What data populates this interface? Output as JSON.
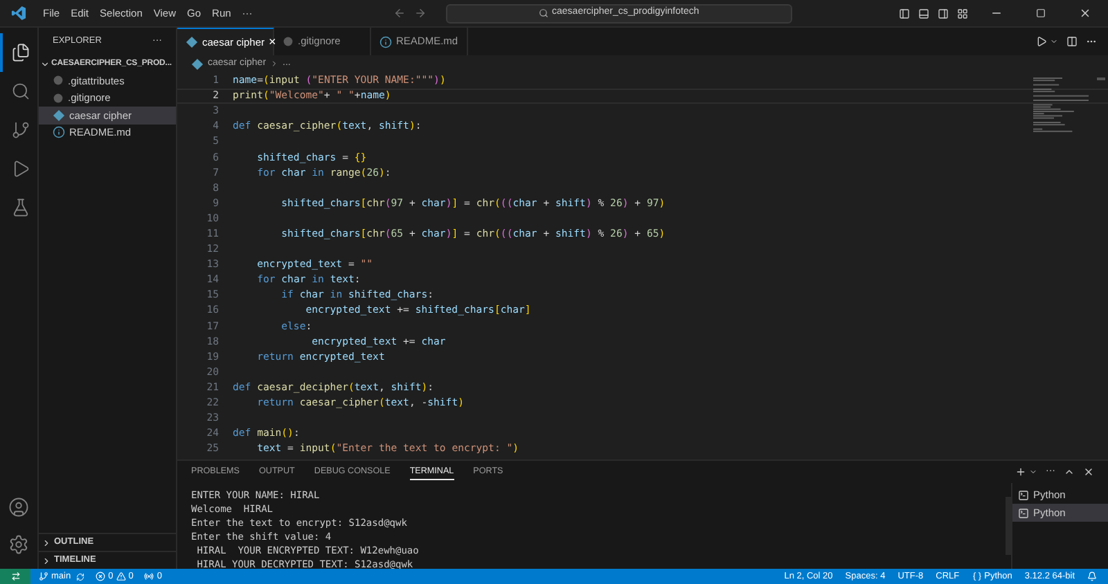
{
  "title_bar": {
    "menus": [
      "File",
      "Edit",
      "Selection",
      "View",
      "Go",
      "Run",
      "···"
    ],
    "search": {
      "value": "caesaercipher_cs_prodigyinfotech"
    }
  },
  "activity_bar": {
    "items": [
      {
        "kind": "files",
        "selected": true
      },
      {
        "kind": "search",
        "selected": false
      },
      {
        "kind": "source-control",
        "selected": false
      },
      {
        "kind": "run",
        "selected": false
      },
      {
        "kind": "testing",
        "selected": false
      }
    ]
  },
  "sidebar": {
    "title": "EXPLORER",
    "more": "···",
    "folder": {
      "name": "CAESAERCIPHER_CS_PROD...",
      "expanded": true,
      "files": [
        {
          "name": ".gitattributes",
          "kind": "config",
          "selected": false
        },
        {
          "name": ".gitignore",
          "kind": "config",
          "selected": false
        },
        {
          "name": "caesar cipher",
          "kind": "python",
          "selected": true
        },
        {
          "name": "README.md",
          "kind": "info",
          "selected": false
        }
      ]
    },
    "sections": [
      {
        "label": "OUTLINE",
        "expanded": false
      },
      {
        "label": "TIMELINE",
        "expanded": false
      }
    ]
  },
  "tabs": [
    {
      "label": "caesar cipher",
      "kind": "python",
      "selected": true,
      "close": "×"
    },
    {
      "label": ".gitignore",
      "kind": "config",
      "selected": false
    },
    {
      "label": "README.md",
      "kind": "info",
      "selected": false
    }
  ],
  "breadcrumb": {
    "file": "caesar cipher",
    "rest": "..."
  },
  "editor": {
    "lines": [
      {
        "number": "1",
        "current": false,
        "tokens": [
          {
            "kind": "var",
            "text": "name"
          },
          {
            "kind": "plain",
            "text": "="
          },
          {
            "kind": "bracket",
            "text": "("
          },
          {
            "kind": "func",
            "text": "input "
          },
          {
            "kind": "bracket2",
            "text": "("
          },
          {
            "kind": "string",
            "text": "\"ENTER YOUR NAME:\"\"\""
          },
          {
            "kind": "bracket2",
            "text": ")"
          },
          {
            "kind": "bracket",
            "text": ")"
          }
        ]
      },
      {
        "number": "2",
        "current": true,
        "tokens": [
          {
            "kind": "func",
            "text": "print"
          },
          {
            "kind": "bracket",
            "text": "("
          },
          {
            "kind": "string",
            "text": "\"Welcome\""
          },
          {
            "kind": "plain",
            "text": "+ "
          },
          {
            "kind": "string",
            "text": "\" \""
          },
          {
            "kind": "plain",
            "text": "+"
          },
          {
            "kind": "var",
            "text": "name"
          },
          {
            "kind": "bracket",
            "text": ")"
          }
        ]
      },
      {
        "number": "3",
        "current": false
      },
      {
        "number": "4",
        "current": false,
        "tokens": [
          {
            "kind": "keyword",
            "text": "def "
          },
          {
            "kind": "func",
            "text": "caesar_cipher"
          },
          {
            "kind": "bracket",
            "text": "("
          },
          {
            "kind": "var",
            "text": "text"
          },
          {
            "kind": "plain",
            "text": ", "
          },
          {
            "kind": "var",
            "text": "shift"
          },
          {
            "kind": "bracket",
            "text": ")"
          },
          {
            "kind": "plain",
            "text": ":"
          }
        ]
      },
      {
        "number": "5",
        "current": false
      },
      {
        "number": "6",
        "current": false,
        "tokens": [
          {
            "kind": "var",
            "text": "    shifted_chars"
          },
          {
            "kind": "plain",
            "text": " = "
          },
          {
            "kind": "bracket",
            "text": "{}"
          }
        ]
      },
      {
        "number": "7",
        "current": false,
        "tokens": [
          {
            "kind": "keyword",
            "text": "    for "
          },
          {
            "kind": "var",
            "text": "char "
          },
          {
            "kind": "keyword",
            "text": "in "
          },
          {
            "kind": "func",
            "text": "range"
          },
          {
            "kind": "bracket",
            "text": "("
          },
          {
            "kind": "number",
            "text": "26"
          },
          {
            "kind": "bracket",
            "text": ")"
          },
          {
            "kind": "plain",
            "text": ":"
          }
        ]
      },
      {
        "number": "8",
        "current": false
      },
      {
        "number": "9",
        "current": false,
        "tokens": [
          {
            "kind": "var",
            "text": "        shifted_chars"
          },
          {
            "kind": "bracket",
            "text": "["
          },
          {
            "kind": "func",
            "text": "chr"
          },
          {
            "kind": "bracket2",
            "text": "("
          },
          {
            "kind": "number",
            "text": "97"
          },
          {
            "kind": "plain",
            "text": " + "
          },
          {
            "kind": "var",
            "text": "char"
          },
          {
            "kind": "bracket2",
            "text": ")"
          },
          {
            "kind": "bracket",
            "text": "]"
          },
          {
            "kind": "plain",
            "text": " = "
          },
          {
            "kind": "func",
            "text": "chr"
          },
          {
            "kind": "bracket",
            "text": "("
          },
          {
            "kind": "bracket2",
            "text": "(("
          },
          {
            "kind": "var",
            "text": "char"
          },
          {
            "kind": "plain",
            "text": " + "
          },
          {
            "kind": "var",
            "text": "shift"
          },
          {
            "kind": "bracket2",
            "text": ")"
          },
          {
            "kind": "plain",
            "text": " % "
          },
          {
            "kind": "number",
            "text": "26"
          },
          {
            "kind": "bracket2",
            "text": ")"
          },
          {
            "kind": "plain",
            "text": " + "
          },
          {
            "kind": "number",
            "text": "97"
          },
          {
            "kind": "bracket",
            "text": ")"
          }
        ]
      },
      {
        "number": "10",
        "current": false
      },
      {
        "number": "11",
        "current": false,
        "tokens": [
          {
            "kind": "var",
            "text": "        shifted_chars"
          },
          {
            "kind": "bracket",
            "text": "["
          },
          {
            "kind": "func",
            "text": "chr"
          },
          {
            "kind": "bracket2",
            "text": "("
          },
          {
            "kind": "number",
            "text": "65"
          },
          {
            "kind": "plain",
            "text": " + "
          },
          {
            "kind": "var",
            "text": "char"
          },
          {
            "kind": "bracket2",
            "text": ")"
          },
          {
            "kind": "bracket",
            "text": "]"
          },
          {
            "kind": "plain",
            "text": " = "
          },
          {
            "kind": "func",
            "text": "chr"
          },
          {
            "kind": "bracket",
            "text": "("
          },
          {
            "kind": "bracket2",
            "text": "(("
          },
          {
            "kind": "var",
            "text": "char"
          },
          {
            "kind": "plain",
            "text": " + "
          },
          {
            "kind": "var",
            "text": "shift"
          },
          {
            "kind": "bracket2",
            "text": ")"
          },
          {
            "kind": "plain",
            "text": " % "
          },
          {
            "kind": "number",
            "text": "26"
          },
          {
            "kind": "bracket2",
            "text": ")"
          },
          {
            "kind": "plain",
            "text": " + "
          },
          {
            "kind": "number",
            "text": "65"
          },
          {
            "kind": "bracket",
            "text": ")"
          }
        ]
      },
      {
        "number": "12",
        "current": false
      },
      {
        "number": "13",
        "current": false,
        "tokens": [
          {
            "kind": "var",
            "text": "    encrypted_text"
          },
          {
            "kind": "plain",
            "text": " = "
          },
          {
            "kind": "string",
            "text": "\"\""
          }
        ]
      },
      {
        "number": "14",
        "current": false,
        "tokens": [
          {
            "kind": "keyword",
            "text": "    for "
          },
          {
            "kind": "var",
            "text": "char "
          },
          {
            "kind": "keyword",
            "text": "in "
          },
          {
            "kind": "var",
            "text": "text"
          },
          {
            "kind": "plain",
            "text": ":"
          }
        ]
      },
      {
        "number": "15",
        "current": false,
        "tokens": [
          {
            "kind": "keyword",
            "text": "        if "
          },
          {
            "kind": "var",
            "text": "char "
          },
          {
            "kind": "keyword",
            "text": "in "
          },
          {
            "kind": "var",
            "text": "shifted_chars"
          },
          {
            "kind": "plain",
            "text": ":"
          }
        ]
      },
      {
        "number": "16",
        "current": false,
        "tokens": [
          {
            "kind": "var",
            "text": "            encrypted_text"
          },
          {
            "kind": "plain",
            "text": " += "
          },
          {
            "kind": "var",
            "text": "shifted_chars"
          },
          {
            "kind": "bracket",
            "text": "["
          },
          {
            "kind": "var",
            "text": "char"
          },
          {
            "kind": "bracket",
            "text": "]"
          }
        ]
      },
      {
        "number": "17",
        "current": false,
        "tokens": [
          {
            "kind": "keyword",
            "text": "        else"
          },
          {
            "kind": "plain",
            "text": ":"
          }
        ]
      },
      {
        "number": "18",
        "current": false,
        "tokens": [
          {
            "kind": "var",
            "text": "             encrypted_text"
          },
          {
            "kind": "plain",
            "text": " += "
          },
          {
            "kind": "var",
            "text": "char"
          }
        ]
      },
      {
        "number": "19",
        "current": false,
        "tokens": [
          {
            "kind": "keyword",
            "text": "    return "
          },
          {
            "kind": "var",
            "text": "encrypted_text"
          }
        ]
      },
      {
        "number": "20",
        "current": false
      },
      {
        "number": "21",
        "current": false,
        "tokens": [
          {
            "kind": "keyword",
            "text": "def "
          },
          {
            "kind": "func",
            "text": "caesar_decipher"
          },
          {
            "kind": "bracket",
            "text": "("
          },
          {
            "kind": "var",
            "text": "text"
          },
          {
            "kind": "plain",
            "text": ", "
          },
          {
            "kind": "var",
            "text": "shift"
          },
          {
            "kind": "bracket",
            "text": ")"
          },
          {
            "kind": "plain",
            "text": ":"
          }
        ]
      },
      {
        "number": "22",
        "current": false,
        "tokens": [
          {
            "kind": "keyword",
            "text": "    return "
          },
          {
            "kind": "func",
            "text": "caesar_cipher"
          },
          {
            "kind": "bracket",
            "text": "("
          },
          {
            "kind": "var",
            "text": "text"
          },
          {
            "kind": "plain",
            "text": ", -"
          },
          {
            "kind": "var",
            "text": "shift"
          },
          {
            "kind": "bracket",
            "text": ")"
          }
        ]
      },
      {
        "number": "23",
        "current": false
      },
      {
        "number": "24",
        "current": false,
        "tokens": [
          {
            "kind": "keyword",
            "text": "def "
          },
          {
            "kind": "func",
            "text": "main"
          },
          {
            "kind": "bracket",
            "text": "()"
          },
          {
            "kind": "plain",
            "text": ":"
          }
        ]
      },
      {
        "number": "25",
        "current": false,
        "tokens": [
          {
            "kind": "var",
            "text": "    text"
          },
          {
            "kind": "plain",
            "text": " = "
          },
          {
            "kind": "func",
            "text": "input"
          },
          {
            "kind": "bracket",
            "text": "("
          },
          {
            "kind": "string",
            "text": "\"Enter the text to encrypt: \""
          },
          {
            "kind": "bracket",
            "text": ")"
          }
        ]
      }
    ]
  },
  "panel": {
    "tabs": [
      {
        "label": "PROBLEMS",
        "selected": false
      },
      {
        "label": "OUTPUT",
        "selected": false
      },
      {
        "label": "DEBUG CONSOLE",
        "selected": false
      },
      {
        "label": "TERMINAL",
        "selected": true
      },
      {
        "label": "PORTS",
        "selected": false
      }
    ],
    "more": "···",
    "terminal_lines": [
      "ENTER YOUR NAME: HIRAL",
      "Welcome  HIRAL",
      "Enter the text to encrypt: S12asd@qwk",
      "Enter the shift value: 4",
      " HIRAL  YOUR ENCRYPTED TEXT: W12ewh@uao",
      " HIRAL YOUR DECRYPTED TEXT: S12asd@qwk"
    ],
    "terminals": [
      {
        "label": "Python",
        "selected": false
      },
      {
        "label": "Python",
        "selected": true
      }
    ]
  },
  "status_bar": {
    "branch": "main",
    "errors": "0",
    "warnings": "0",
    "ports": "0",
    "position": "Ln 2, Col 20",
    "spaces": "Spaces: 4",
    "encoding": "UTF-8",
    "eol": "CRLF",
    "language": "Python",
    "interpreter": "3.12.2 64-bit"
  }
}
